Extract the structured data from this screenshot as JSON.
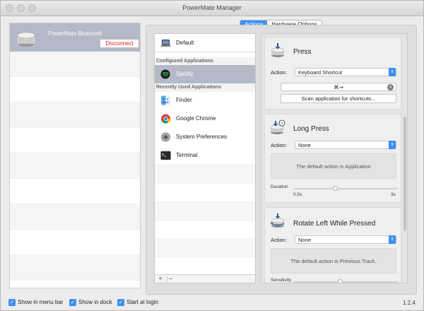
{
  "window": {
    "title": "PowerMate Manager"
  },
  "devices": {
    "selected": {
      "name": "PowerMate Bluetooth",
      "disconnect_label": "Disconnect"
    }
  },
  "tabs": [
    {
      "label": "Actions",
      "active": true
    },
    {
      "label": "Hardware Options",
      "active": false
    }
  ],
  "apps": {
    "default_label": "Default",
    "configured_header": "Configured Applications",
    "configured": [
      {
        "label": "Spotify",
        "icon": "spotify-icon",
        "selected": true
      }
    ],
    "recent_header": "Recently Used Applications",
    "recent": [
      {
        "label": "Finder",
        "icon": "finder-icon"
      },
      {
        "label": "Google Chrome",
        "icon": "chrome-icon"
      },
      {
        "label": "System Preferences",
        "icon": "gear-icon"
      },
      {
        "label": "Terminal",
        "icon": "terminal-icon"
      }
    ],
    "add_label": "+",
    "remove_label": "−"
  },
  "actions": {
    "press": {
      "title": "Press",
      "action_label": "Action:",
      "action_value": "Keyboard Shortcut",
      "shortcut": "⌘→",
      "scan_label": "Scan application for shortcuts..."
    },
    "long_press": {
      "title": "Long Press",
      "action_label": "Action:",
      "action_value": "None",
      "info": "The default action is Application",
      "duration_label": "Duration",
      "duration_min": "0.5s",
      "duration_max": "3s",
      "duration_level": 0.4
    },
    "rotate_left_pressed": {
      "title": "Rotate Left While Pressed",
      "action_label": "Action:",
      "action_value": "None",
      "info": "The default action is Previous Track.",
      "sensitivity_label": "Sensitivity",
      "sensitivity_level": 0.45
    }
  },
  "footer": {
    "show_in_menu_bar": "Show in menu bar",
    "show_in_dock": "Show in dock",
    "start_at_login": "Start at login",
    "version": "1.2.4"
  },
  "colors": {
    "accent": "#3d8ef5",
    "selection": "#b5b9c7",
    "disconnect": "#e02020"
  }
}
